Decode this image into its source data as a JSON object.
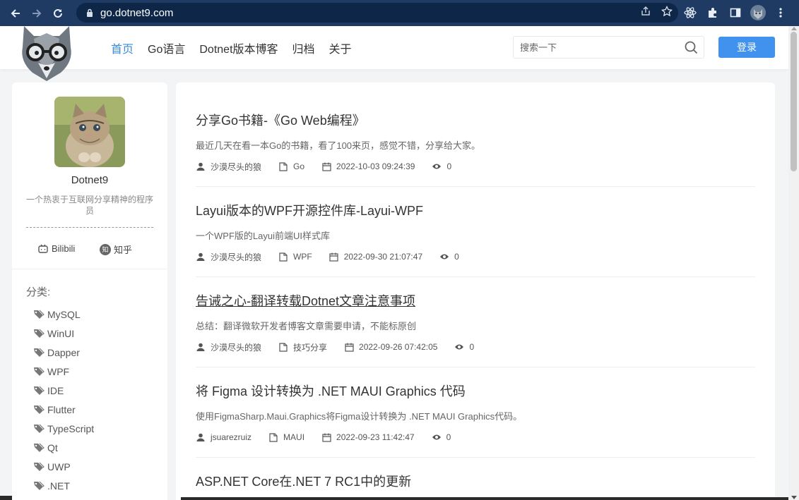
{
  "browser": {
    "url": "go.dotnet9.com"
  },
  "header": {
    "nav": [
      {
        "label": "首页",
        "active": true
      },
      {
        "label": "Go语言",
        "active": false
      },
      {
        "label": "Dotnet版本博客",
        "active": false
      },
      {
        "label": "归档",
        "active": false
      },
      {
        "label": "关于",
        "active": false
      }
    ],
    "search_placeholder": "搜索一下",
    "login_label": "登录",
    "accent": "#3b8bd9",
    "login_color": "#4192ef"
  },
  "profile": {
    "name": "Dotnet9",
    "description": "一个热衷于互联网分享精神的程序员",
    "social": [
      {
        "label": "Bilibili",
        "icon": "bilibili-icon"
      },
      {
        "label": "知乎",
        "icon": "zhihu-icon",
        "badge": "知"
      }
    ]
  },
  "categories": {
    "title": "分类:",
    "items": [
      "MySQL",
      "WinUI",
      "Dapper",
      "WPF",
      "IDE",
      "Flutter",
      "TypeScript",
      "Qt",
      "UWP",
      ".NET"
    ]
  },
  "articles": [
    {
      "title": "分享Go书籍-《Go Web编程》",
      "excerpt": "最近几天在看一本Go的书籍，看了100来页，感觉不错，分享给大家。",
      "author": "沙漠尽头的狼",
      "category": "Go",
      "date": "2022-10-03 09:24:39",
      "views": "0"
    },
    {
      "title": "Layui版本的WPF开源控件库-Layui-WPF",
      "excerpt": "一个WPF版的Layui前端UI样式库",
      "author": "沙漠尽头的狼",
      "category": "WPF",
      "date": "2022-09-30 21:07:47",
      "views": "0"
    },
    {
      "title": "告诫之心-翻译转载Dotnet文章注意事项",
      "excerpt": "总结：翻译微软开发者博客文章需要申请，不能标原创",
      "author": "沙漠尽头的狼",
      "category": "技巧分享",
      "date": "2022-09-26 07:42:05",
      "views": "0",
      "hovered": true
    },
    {
      "title": "将 Figma 设计转换为 .NET MAUI Graphics 代码",
      "excerpt": "使用FigmaSharp.Maui.Graphics将Figma设计转换为 .NET MAUI Graphics代码。",
      "author": "jsuarezruiz",
      "category": "MAUI",
      "date": "2022-09-23 11:42:47",
      "views": "0"
    },
    {
      "title": "ASP.NET Core在.NET 7 RC1中的更新"
    }
  ]
}
